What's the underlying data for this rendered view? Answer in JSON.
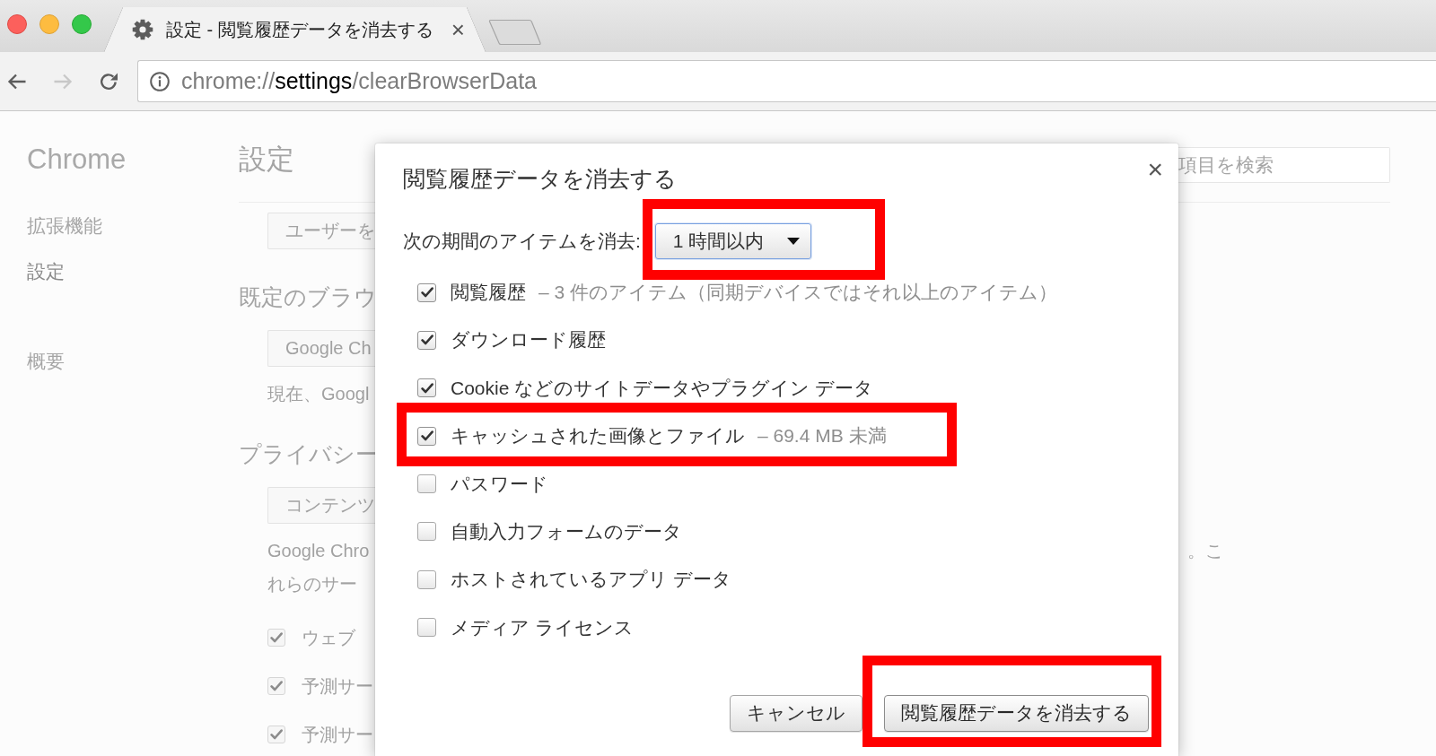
{
  "window": {
    "controls": [
      {
        "kind": "close"
      },
      {
        "kind": "minimize"
      },
      {
        "kind": "zoom"
      }
    ]
  },
  "tabs": [
    {
      "title": "設定 - 閲覧履歴データを消去する",
      "close": "×",
      "selected": true
    }
  ],
  "toolbar": {
    "buttons": [
      {
        "kind": "back",
        "disabled": false
      },
      {
        "kind": "forward",
        "disabled": true
      },
      {
        "kind": "reload",
        "disabled": false
      }
    ],
    "address": "chrome://**settings**/clearBrowserData"
  },
  "settings_page": {
    "brand": "Chrome",
    "sidebar": {
      "groups": [
        {
          "items": [
            {
              "label": "拡張機能",
              "selected": false
            },
            {
              "label": "設定",
              "selected": true
            }
          ]
        },
        {
          "items": [
            {
              "label": "概要",
              "selected": false
            }
          ]
        }
      ]
    },
    "title": "設定",
    "search": {
      "placeholder": "項目を検索"
    },
    "content": [
      {
        "kind": "button",
        "label": "ユーザーを"
      },
      {
        "kind": "heading",
        "label": "既定のブラウ"
      },
      {
        "kind": "button",
        "label": "Google Ch"
      },
      {
        "kind": "text",
        "label": "現在、Googl"
      },
      {
        "kind": "heading",
        "label": "プライバシー"
      },
      {
        "kind": "button",
        "label": "コンテンツ"
      },
      {
        "kind": "text",
        "label": "Google Chro",
        "tail": "。こ"
      },
      {
        "kind": "text",
        "label": "れらのサー"
      },
      {
        "kind": "checkbox",
        "label": "ウェブ",
        "checked": true
      },
      {
        "kind": "checkbox",
        "label": "予測サー",
        "checked": true
      },
      {
        "kind": "checkbox",
        "label": "予測サー",
        "checked": true
      }
    ]
  },
  "dialog": {
    "title": "閲覧履歴データを消去する",
    "close": "×",
    "range": {
      "label": "次の期間のアイテムを消去:",
      "value": "1 時間以内",
      "highlighted": true
    },
    "items": [
      {
        "label": "閲覧履歴",
        "detail": "– 3 件のアイテム（同期デバイスではそれ以上のアイテム）",
        "checked": true,
        "highlighted": false
      },
      {
        "label": "ダウンロード履歴",
        "checked": true,
        "highlighted": false
      },
      {
        "label": "Cookie などのサイトデータやプラグイン データ",
        "checked": true,
        "highlighted": false
      },
      {
        "label": "キャッシュされた画像とファイル",
        "detail": "– 69.4 MB 未満",
        "checked": true,
        "highlighted": true
      },
      {
        "label": "パスワード",
        "checked": false,
        "highlighted": false
      },
      {
        "label": "自動入力フォームのデータ",
        "checked": false,
        "highlighted": false
      },
      {
        "label": "ホストされているアプリ データ",
        "checked": false,
        "highlighted": false
      },
      {
        "label": "メディア ライセンス",
        "checked": false,
        "highlighted": false
      }
    ],
    "buttons": [
      {
        "kind": "cancel",
        "label": "キャンセル",
        "highlighted": false
      },
      {
        "kind": "confirm",
        "label": "閲覧履歴データを消去する",
        "highlighted": true
      }
    ]
  }
}
